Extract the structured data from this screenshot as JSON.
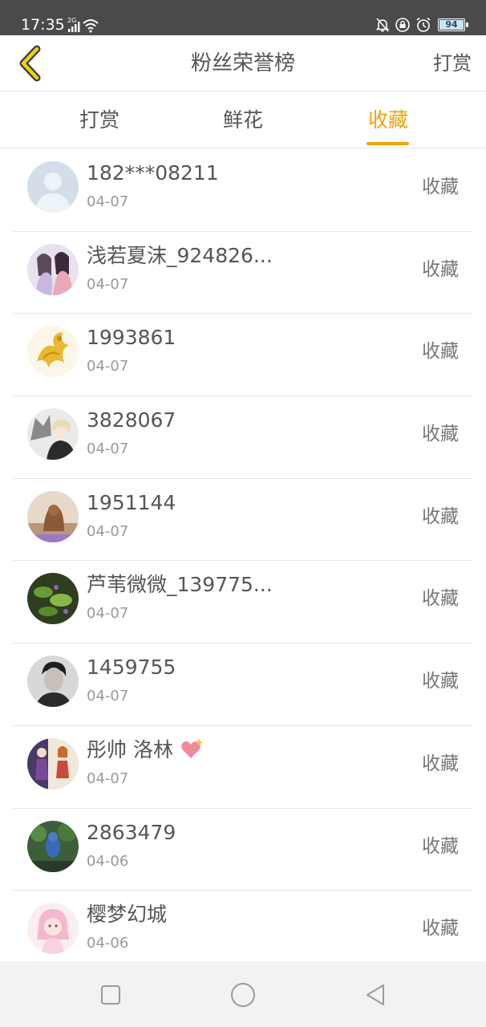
{
  "status_bar": {
    "time": "17:35",
    "network": "2G",
    "battery": "94"
  },
  "header": {
    "title": "粉丝荣誉榜",
    "action_label": "打赏"
  },
  "tabs": [
    {
      "label": "打赏",
      "active": false
    },
    {
      "label": "鲜花",
      "active": false
    },
    {
      "label": "收藏",
      "active": true
    }
  ],
  "colors": {
    "accent": "#f0a30a",
    "text": "#555555",
    "muted": "#999999",
    "divider": "#e6e6e6"
  },
  "fans": [
    {
      "name": "182***08211",
      "date": "04-07",
      "action": "收藏"
    },
    {
      "name": "浅若夏沫_924826...",
      "date": "04-07",
      "action": "收藏"
    },
    {
      "name": "1993861",
      "date": "04-07",
      "action": "收藏"
    },
    {
      "name": "3828067",
      "date": "04-07",
      "action": "收藏"
    },
    {
      "name": "1951144",
      "date": "04-07",
      "action": "收藏"
    },
    {
      "name": "芦苇微微_139775...",
      "date": "04-07",
      "action": "收藏"
    },
    {
      "name": "1459755",
      "date": "04-07",
      "action": "收藏"
    },
    {
      "name": "彤帅 洛林",
      "date": "04-07",
      "action": "收藏"
    },
    {
      "name": "2863479",
      "date": "04-06",
      "action": "收藏"
    },
    {
      "name": "樱梦幻城",
      "date": "04-06",
      "action": "收藏"
    }
  ]
}
